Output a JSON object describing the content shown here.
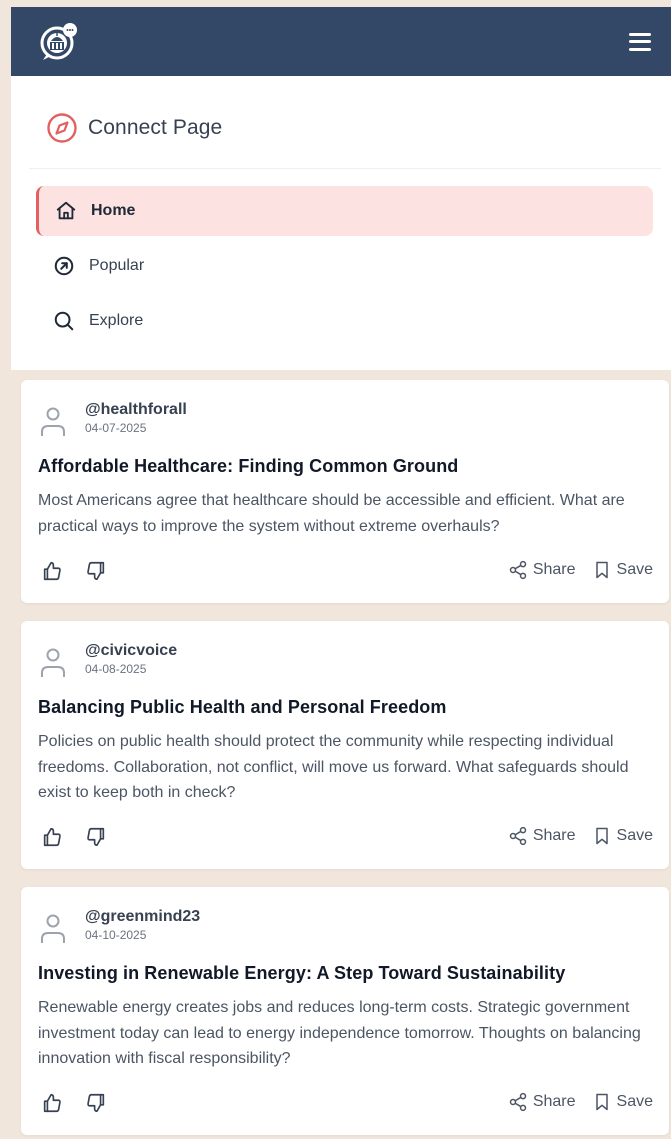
{
  "header": {
    "logo_icon": "capitol-chat-logo-icon",
    "menu_icon": "hamburger-menu-icon",
    "bg_color": "#334766"
  },
  "nav": {
    "brand_title": "Connect Page",
    "brand_icon": "compass-icon",
    "accent_color": "#e26060",
    "items": [
      {
        "label": "Home",
        "icon": "home-icon",
        "active": true
      },
      {
        "label": "Popular",
        "icon": "trending-arrow-icon",
        "active": false
      },
      {
        "label": "Explore",
        "icon": "search-icon",
        "active": false
      }
    ]
  },
  "posts": [
    {
      "username": "@healthforall",
      "date": "04-07-2025",
      "title": "Affordable Healthcare: Finding Common Ground",
      "body": "Most Americans agree that healthcare should be accessible and efficient. What are practical ways to improve the system without extreme overhauls?"
    },
    {
      "username": "@civicvoice",
      "date": "04-08-2025",
      "title": "Balancing Public Health and Personal Freedom",
      "body": "Policies on public health should protect the community while respecting individual freedoms. Collaboration, not conflict, will move us forward. What safeguards should exist to keep both in check?"
    },
    {
      "username": "@greenmind23",
      "date": "04-10-2025",
      "title": "Investing in Renewable Energy: A Step Toward Sustainability",
      "body": "Renewable energy creates jobs and reduces long-term costs. Strategic government investment today can lead to energy independence tomorrow. Thoughts on balancing innovation with fiscal responsibility?"
    }
  ],
  "actions": {
    "share_label": "Share",
    "save_label": "Save"
  }
}
